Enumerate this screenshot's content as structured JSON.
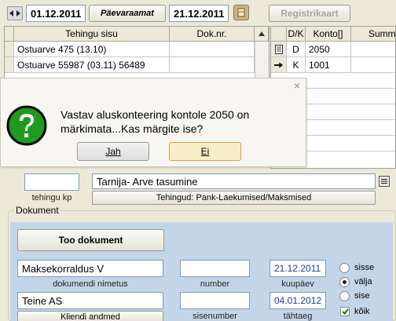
{
  "toolbar": {
    "date_from": "01.12.2011",
    "day_book_label": "Päevaraamat",
    "date_to": "21.12.2011",
    "register_label": "Registrikaart"
  },
  "left_grid": {
    "headers": [
      "Tehingu sisu",
      "Dok.nr."
    ],
    "rows": [
      {
        "sisu": "Ostuarve 475 (13.10)",
        "dok": ""
      },
      {
        "sisu": "Ostuarve 55987 (03.11) 56489",
        "dok": ""
      }
    ]
  },
  "right_grid": {
    "headers": [
      "D/K",
      "Konto[]",
      "Summ"
    ],
    "rows": [
      {
        "dk": "D",
        "konto": "2050"
      },
      {
        "dk": "K",
        "konto": "1001"
      }
    ]
  },
  "dialog": {
    "close": "×",
    "message_line1": "Vastav aluskonteering kontole 2050 on",
    "message_line2": "märkimata...Kas märgite ise?",
    "yes_label": "Jah",
    "no_label": "Ei"
  },
  "transaction": {
    "kp_label": "tehingu kp",
    "title": "Tarnija- Arve tasumine",
    "subtitle": "Tehingud: Pank-Laekumised/Maksmised"
  },
  "document": {
    "legend": "Dokument",
    "fetch_button": "Too dokument",
    "name_value": "Maksekorraldus V",
    "name_label": "dokumendi nimetus",
    "number_label": "number",
    "receipt_date": "21.12.2011",
    "receipt_label": "kuupäev",
    "client_value": "Teine AS",
    "client_button": "Kliendi andmed",
    "internal_label": "sisenumber",
    "due_date": "04.01.2012",
    "due_label": "tähtaeg",
    "radio_in": "sisse",
    "radio_out": "välja",
    "radio_internal": "sise",
    "checkbox_all": "kõik"
  }
}
